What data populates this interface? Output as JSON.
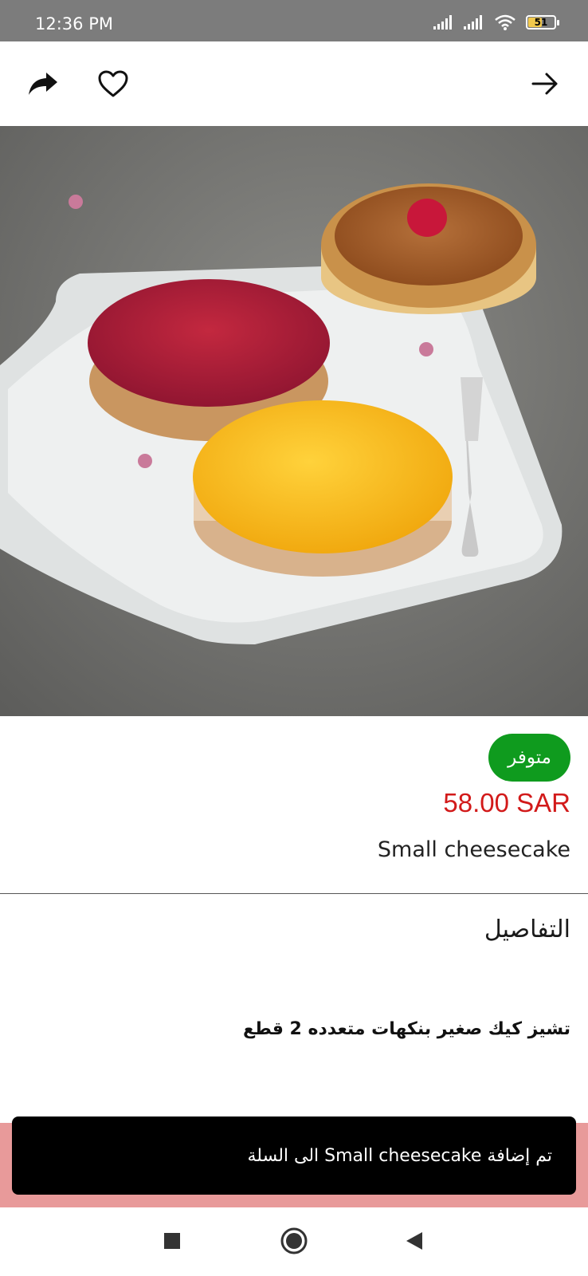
{
  "status_bar": {
    "time": "12:36 PM",
    "battery": "51"
  },
  "product": {
    "availability": "متوفر",
    "price": "58.00 SAR",
    "name": "Small cheesecake"
  },
  "details": {
    "heading": "التفاصيل",
    "description": "تشيز كيك صغير بنكهات متعدده 2 قطع"
  },
  "snackbar": {
    "message": "تم إضافة Small cheesecake الى السلة"
  },
  "colors": {
    "badge": "#0f9b1e",
    "price": "#d21a1a",
    "snackbar": "#000000"
  }
}
